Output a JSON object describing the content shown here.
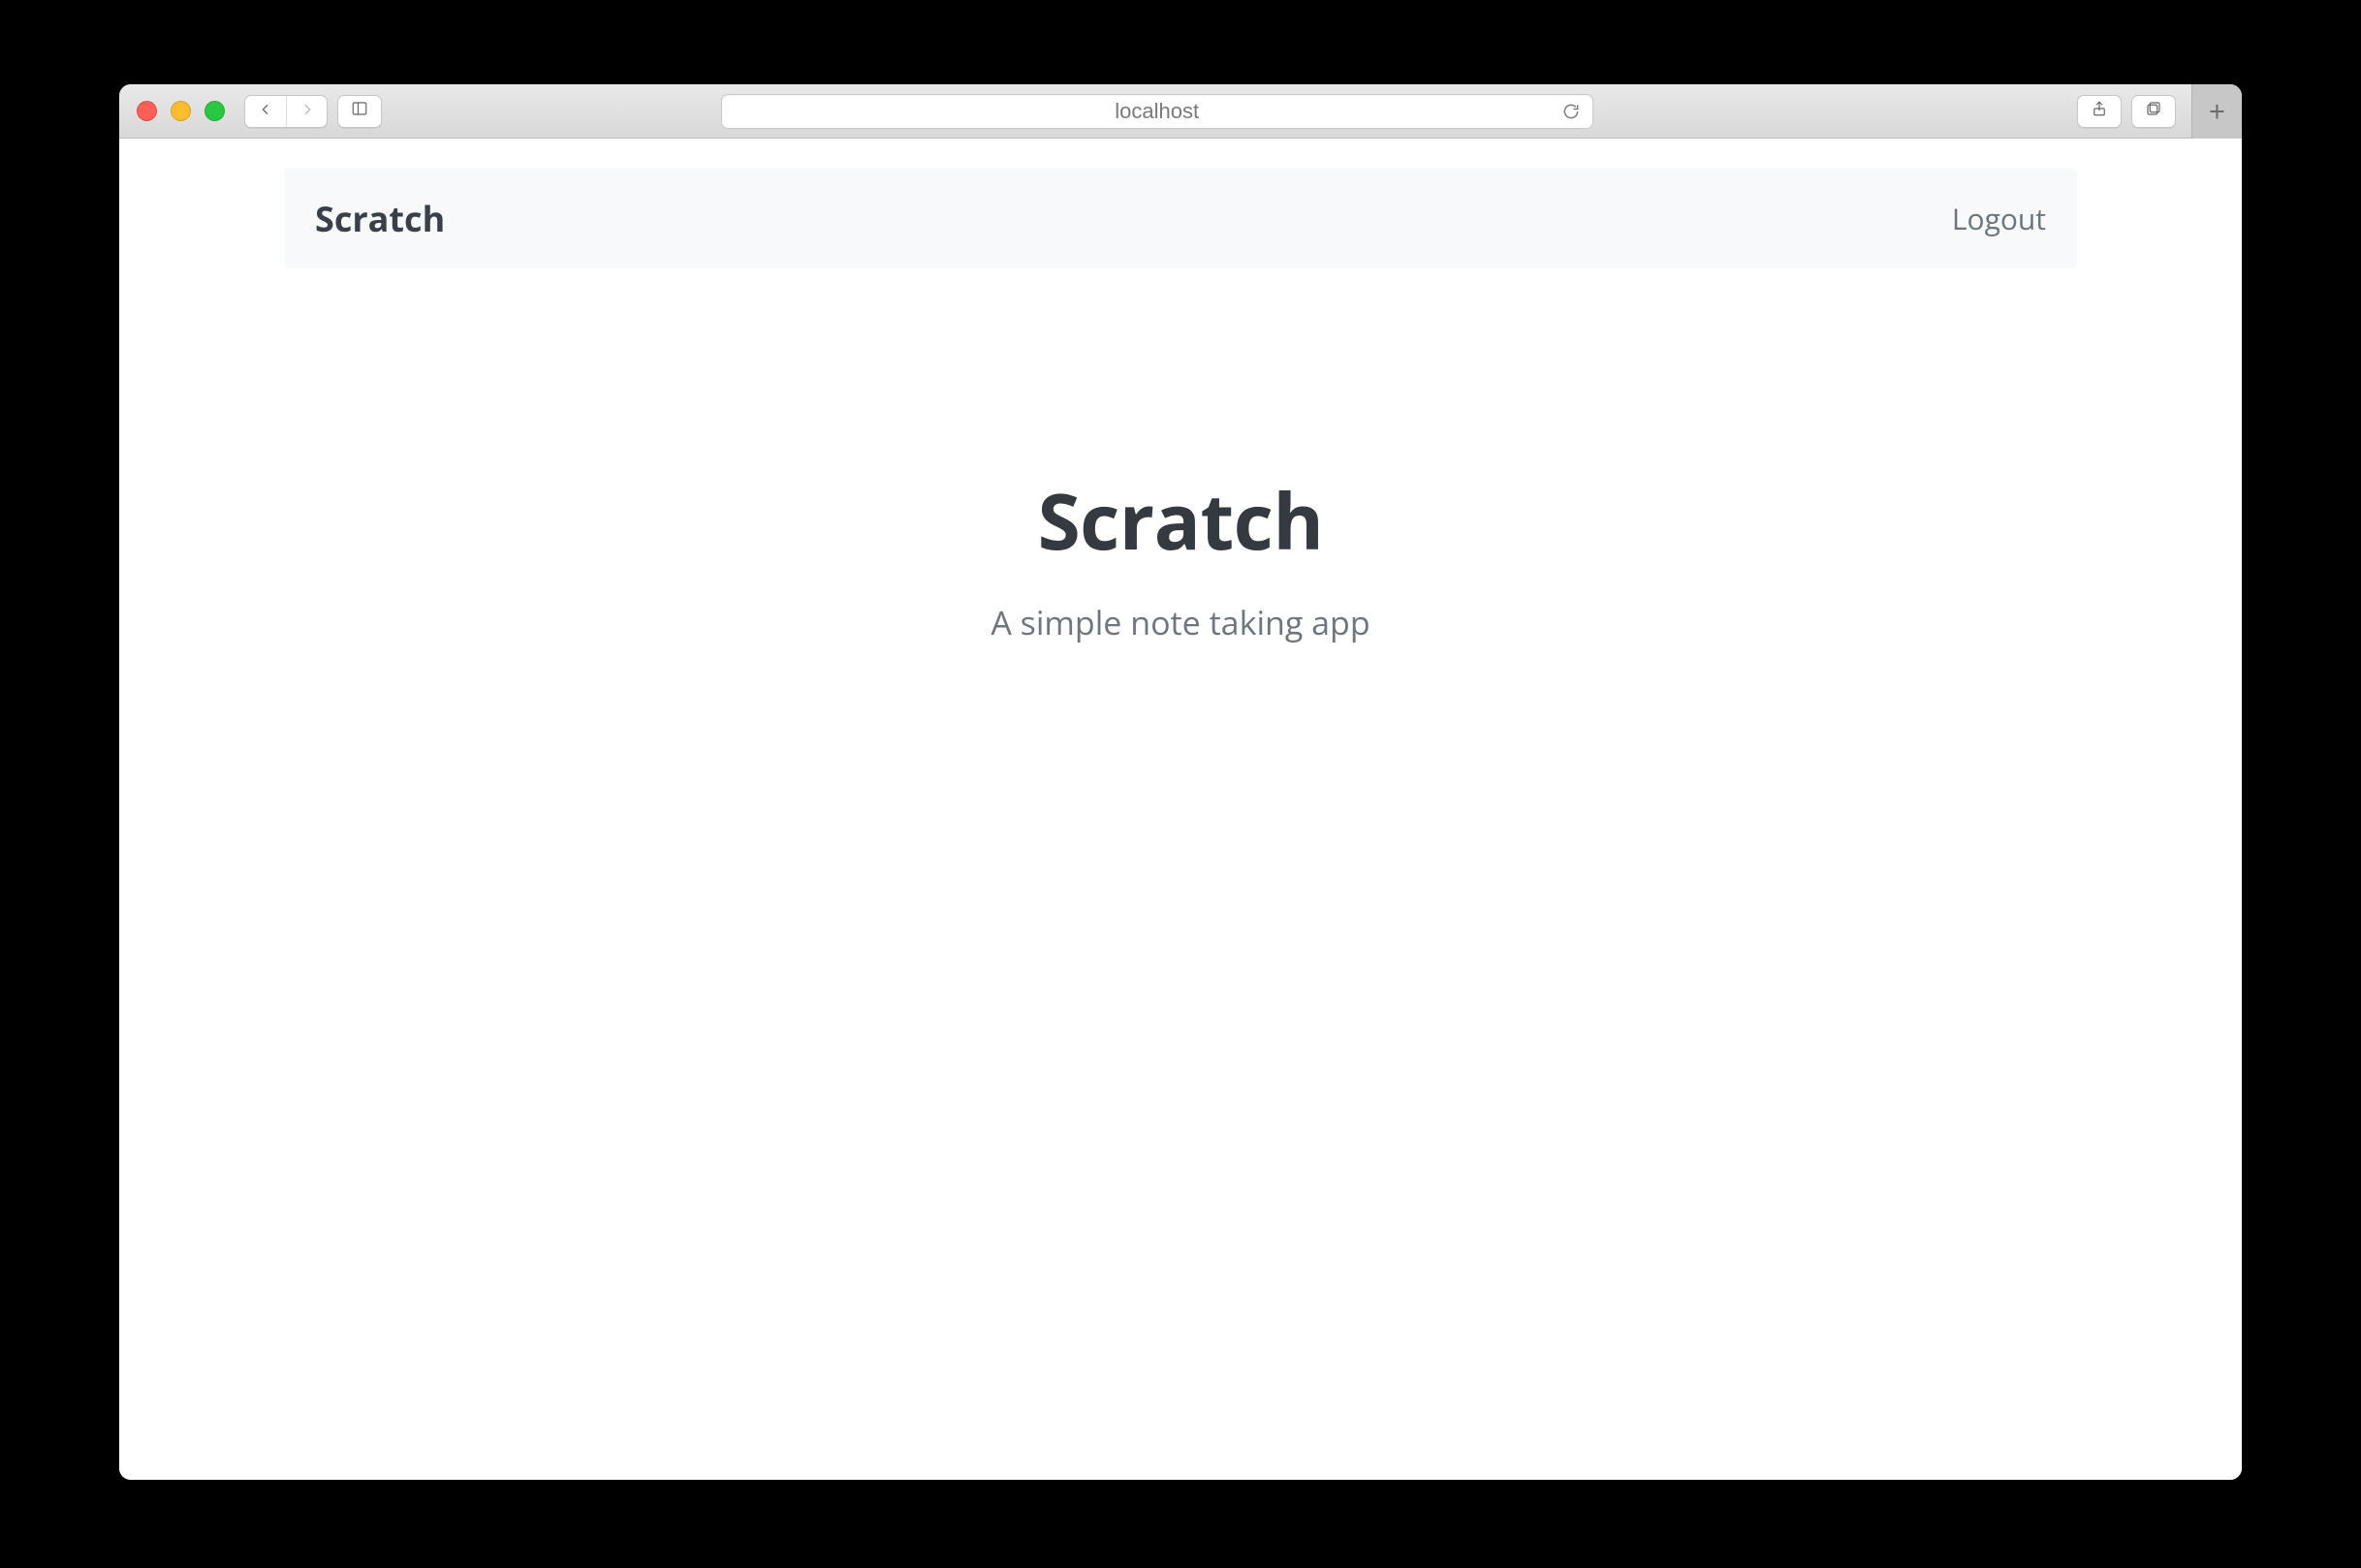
{
  "browser": {
    "url": "localhost"
  },
  "navbar": {
    "brand": "Scratch",
    "logout": "Logout"
  },
  "hero": {
    "title": "Scratch",
    "subtitle": "A simple note taking app"
  }
}
